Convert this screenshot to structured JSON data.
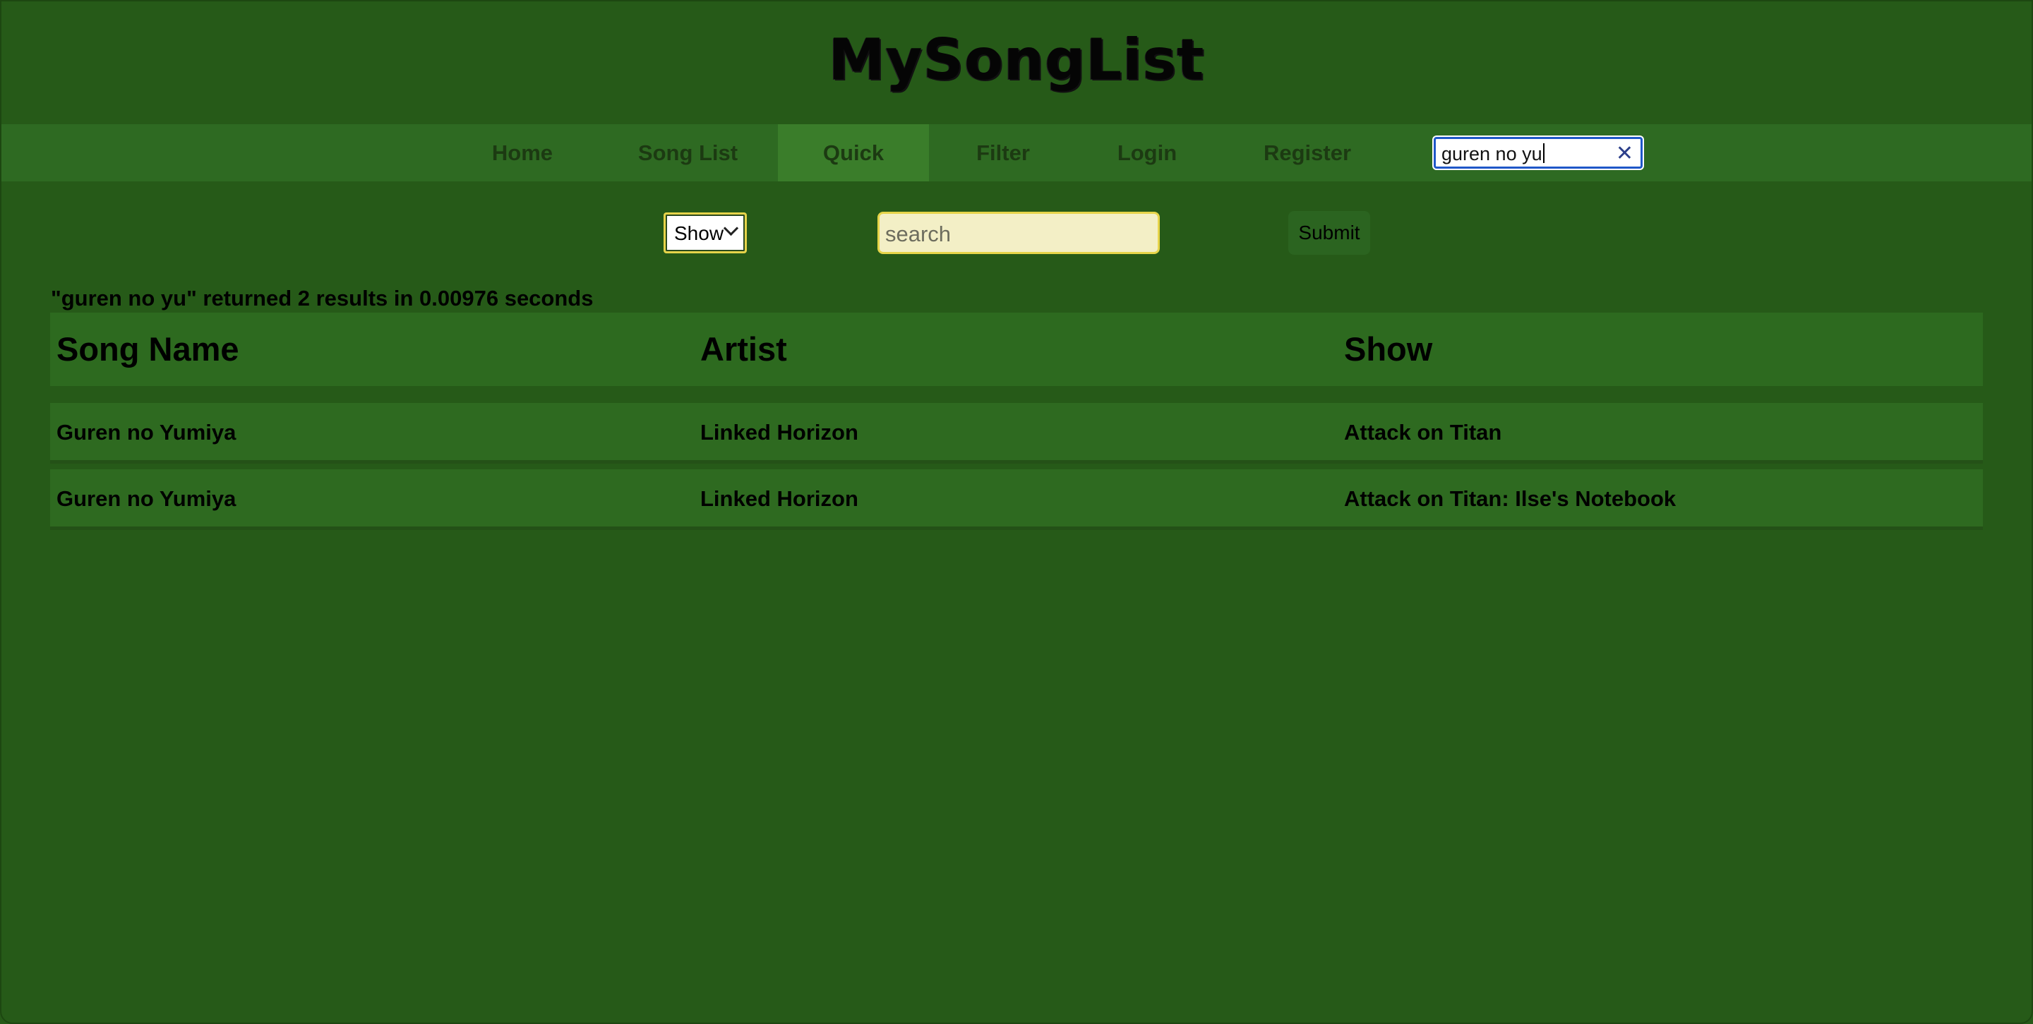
{
  "site": {
    "title": "MySongList"
  },
  "nav": {
    "items": [
      {
        "label": "Home"
      },
      {
        "label": "Song List"
      },
      {
        "label": "Quick"
      },
      {
        "label": "Filter"
      },
      {
        "label": "Login"
      },
      {
        "label": "Register"
      }
    ],
    "active": "Quick",
    "search_value": "guren no yu",
    "clear_icon": "close-icon"
  },
  "search_form": {
    "category_selected": "Show",
    "search_placeholder": "search",
    "submit_label": "Submit"
  },
  "results": {
    "summary": "\"guren no yu\" returned 2 results in 0.00976 seconds",
    "columns": [
      "Song Name",
      "Artist",
      "Show"
    ],
    "rows": [
      {
        "song": "Guren no Yumiya",
        "artist": "Linked Horizon",
        "show": "Attack on Titan"
      },
      {
        "song": "Guren no Yumiya",
        "artist": "Linked Horizon",
        "show": "Attack on Titan: Ilse's Notebook"
      }
    ]
  },
  "colors": {
    "background": "#265a18",
    "navbar": "#2e6a22",
    "nav_active": "#3a7d2a",
    "search_field": "#f3efc6",
    "field_border": "#e6d44a"
  }
}
